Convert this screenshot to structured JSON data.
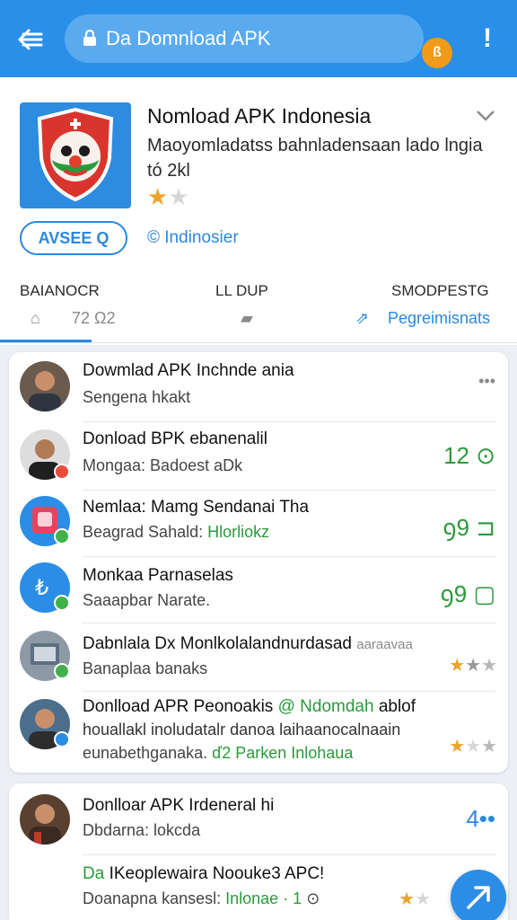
{
  "topbar": {
    "search_text": "Da Domnload APK",
    "badge_text": "ß",
    "menu_glyph": "!"
  },
  "app": {
    "title": "Nomload APK Indonesia",
    "description": "Maoyomladatss bahnladensaan lado lngia tó 2kl",
    "rating": 1,
    "rating_max": 2,
    "install_label": "AVSEE Q",
    "developer": "© Indinosier"
  },
  "tabs": {
    "labels": [
      "BAIANOCR",
      "LL DUP",
      "SMODPESTG"
    ],
    "icon_row_mid": "72 Ω2",
    "active_label": "Pegreimisnats"
  },
  "list": [
    {
      "title": "Dowmlad APK Inchnde ania",
      "subtitle": "Sengena hkakt",
      "meta": "•••"
    },
    {
      "title": "Donload BPK ebanenalil",
      "subtitle": "Mongaa: Badoest aDk",
      "meta": "12 ⊙"
    },
    {
      "title": "Nemlaa: Mamg Sendanai Tha",
      "subtitle": "Beagrad Sahald:",
      "subtitle_green": "Hlorliokz",
      "meta": "ꝯ9 ⊐"
    },
    {
      "title": "Monkaa Parnaselas",
      "subtitle": "Saaapbar Narate.",
      "meta": "ꝯ9 ▢"
    },
    {
      "title": "Dabnlala Dx Monlkolalandnurdasad",
      "title_gray": "aaraavaa",
      "subtitle": "Banaplaa banaks",
      "stars": 1
    },
    {
      "title": "Donlload APR Peonoakis",
      "title_green": "@ Ndomdah",
      "title_end": "ablof",
      "line2": "houallakl inoludatalr danoa laihaanocalnaain",
      "subtitle": "eunabethganaka.",
      "subtitle_green": "ď2 Parken Inlohaua",
      "stars": 1
    }
  ],
  "list2": [
    {
      "title": "Donlloar APK Irdeneral hi",
      "subtitle": "Dbdarna: lokcda",
      "meta": "4••"
    },
    {
      "title_green": "Da",
      "title": "IKeoplewaira Noouke3 APC!",
      "subtitle": "Doanapna kansesl:",
      "subtitle_green": "Inlonae · 1",
      "subtitle_end": "⊙",
      "stars": 1
    }
  ]
}
